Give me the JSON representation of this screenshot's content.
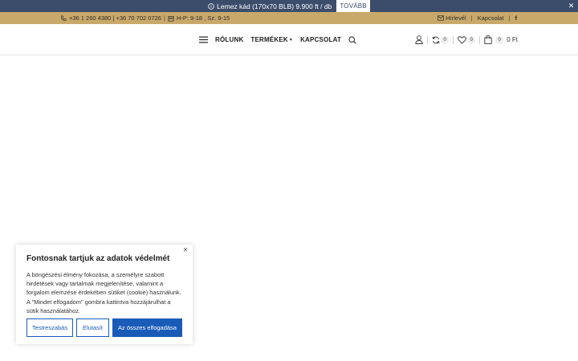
{
  "promo": {
    "text": "Lemez kád (170x70 BLB) 9.900 ft / db",
    "more_label": "TOVÁBB",
    "icon": "info-icon",
    "close_icon": "close-icon"
  },
  "topbar": {
    "phones": "+36 1 260 4380 | +36 70 702 0726",
    "hours": "H-P: 9-18 , Sz: 9-15",
    "newsletter": "Hírlevél",
    "contact": "Kapcsolat",
    "facebook": "f"
  },
  "nav": {
    "items": [
      {
        "label": "RÓLUNK"
      },
      {
        "label": "TERMÉKEK"
      },
      {
        "label": "KAPCSOLAT"
      }
    ]
  },
  "header_icons": {
    "compare_count": "0",
    "wishlist_count": "0",
    "cart_count": "0",
    "cart_total": "0 Ft"
  },
  "cookie": {
    "title": "Fontosnak tartjuk az adatok védelmét",
    "text": "A böngészési élmény fokozása, a személyre szabott hirdetések vagy tartalmak megjelenítése, valamint a forgalom elemzése érdekében sütiket (cookie) használunk. A \"Mindet elfogadom\" gombra kattintva hozzájárulhat a sütik használatához.",
    "customize_label": "Testreszabás",
    "reject_label": "Elutasít",
    "accept_label": "Az összes elfogadása"
  },
  "colors": {
    "promo_bg": "#3b4d6b",
    "topbar_bg": "#c8a96a",
    "accent": "#1a5bb8"
  }
}
